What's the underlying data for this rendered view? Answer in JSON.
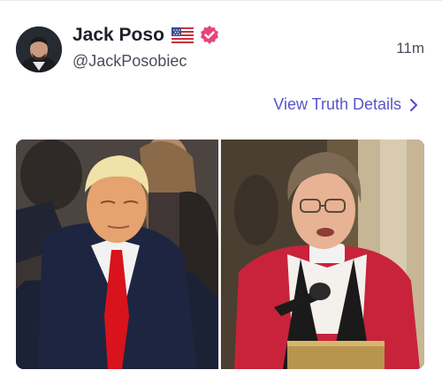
{
  "post": {
    "author_name": "Jack Poso",
    "flag_icon": "us-flag-icon",
    "verified_icon": "verified-badge-icon",
    "handle": "@JackPosobiec",
    "time_ago": "11m",
    "details_link": "View Truth Details",
    "accent_color": "#5a54c8",
    "verified_color": "#e8447a"
  }
}
